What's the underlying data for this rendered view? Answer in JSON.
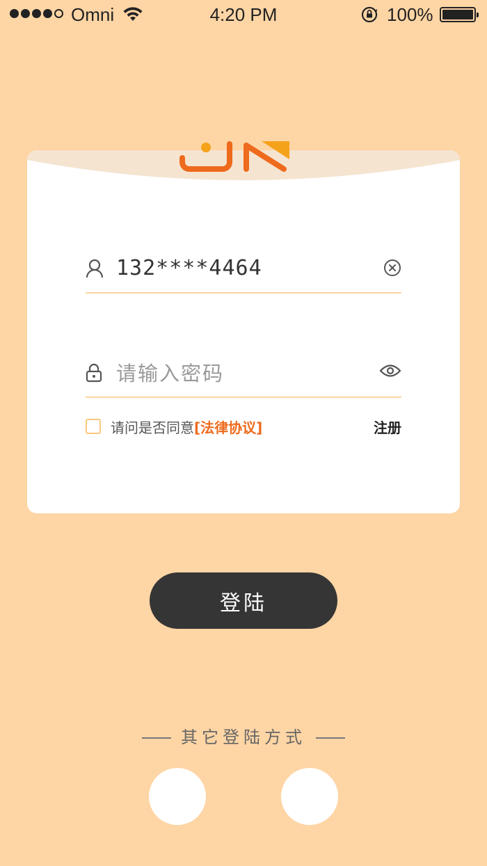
{
  "status_bar": {
    "carrier": "Omni",
    "time": "4:20 PM",
    "battery_percent": "100%",
    "signal_icon": "signal-dots-icon",
    "wifi_icon": "wifi-icon",
    "orientation_icon": "orientation-lock-icon",
    "battery_icon": "battery-icon"
  },
  "logo": {
    "icon": "brand-logo-icon"
  },
  "username": {
    "value": "132****4464",
    "lead_icon": "user-icon",
    "clear_icon": "clear-icon"
  },
  "password": {
    "placeholder": "请输入密码",
    "lead_icon": "lock-icon",
    "toggle_icon": "eye-icon"
  },
  "agreement": {
    "text": "请问是否同意",
    "link": "[法律协议]",
    "checked": false
  },
  "register_label": "注册",
  "login_label": "登陆",
  "other_login": {
    "label": "其它登陆方式"
  },
  "colors": {
    "background": "#FED5A5",
    "accent": "#EE6A1C",
    "button": "#353535",
    "underline": "#FBD59F"
  }
}
